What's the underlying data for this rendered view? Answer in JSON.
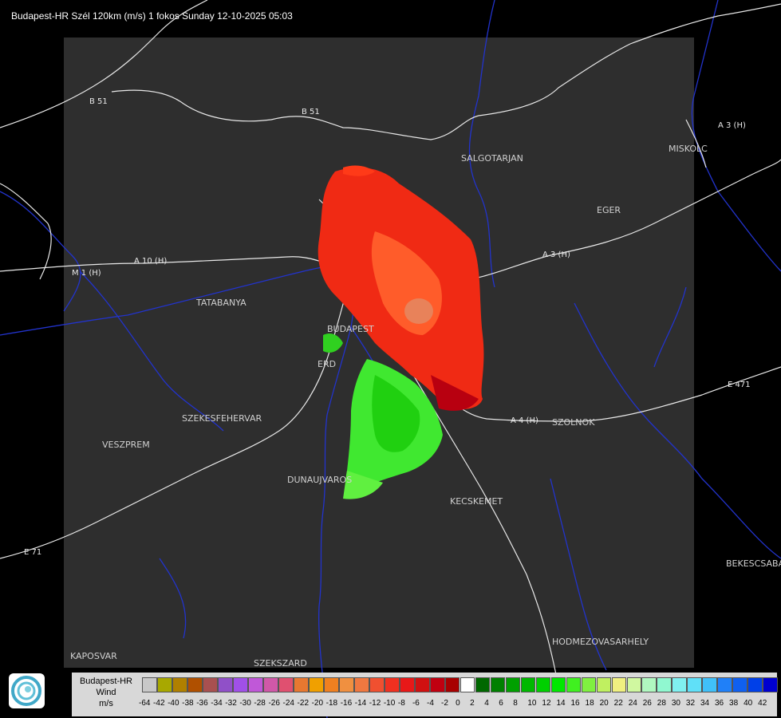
{
  "header": {
    "title": "Budapest-HR Szél 120km (m/s) 1 fokos Sunday 12-10-2025 05:03"
  },
  "cities": [
    {
      "name": "SALGOTARJAN"
    },
    {
      "name": "EGER"
    },
    {
      "name": "MISKOLC"
    },
    {
      "name": "TATABANYA"
    },
    {
      "name": "BUDAPEST"
    },
    {
      "name": "ERD"
    },
    {
      "name": "SZEKESFEHERVAR"
    },
    {
      "name": "VESZPREM"
    },
    {
      "name": "DUNAUJVAROS"
    },
    {
      "name": "KECSKEMET"
    },
    {
      "name": "SZOLNOK"
    },
    {
      "name": "BEKESCSABA"
    },
    {
      "name": "HODMEZOVASARHELY"
    },
    {
      "name": "KAPOSVAR"
    },
    {
      "name": "SZEKSZARD"
    }
  ],
  "roads": [
    "B 51",
    "B 51",
    "A 3 (H)",
    "A 3 (H)",
    "A 4 (H)",
    "E 71",
    "E 471",
    "M 1 (H)",
    "A 10 (H)"
  ],
  "legend": {
    "line1": "Budapest-HR",
    "line2": "Wind",
    "line3": "m/s",
    "colors": [
      "#c8c8c8",
      "#a8a800",
      "#b08000",
      "#b05000",
      "#a85050",
      "#9050c8",
      "#a050e8",
      "#c058d8",
      "#d058a8",
      "#e05070",
      "#e87830",
      "#f0a000",
      "#f08020",
      "#f09040",
      "#f07840",
      "#f05030",
      "#f03020",
      "#e81818",
      "#d01010",
      "#c00010",
      "#a80000",
      "#ffffff",
      "#006800",
      "#008000",
      "#00a000",
      "#00b800",
      "#00d000",
      "#00e800",
      "#40f020",
      "#80f040",
      "#c0f060",
      "#f0f080",
      "#d0f8a0",
      "#b0f8c0",
      "#90f8d0",
      "#80f0f0",
      "#60e0f8",
      "#40c0f8",
      "#2080f8",
      "#1060f0",
      "#0040e8",
      "#0000d0"
    ],
    "ticks": [
      "-64",
      "-42",
      "-40",
      "-38",
      "-36",
      "-34",
      "-32",
      "-30",
      "-28",
      "-26",
      "-24",
      "-22",
      "-20",
      "-18",
      "-16",
      "-14",
      "-12",
      "-10",
      "-8",
      "-6",
      "-4",
      "-2",
      "0",
      "2",
      "4",
      "6",
      "8",
      "10",
      "12",
      "14",
      "16",
      "18",
      "20",
      "22",
      "24",
      "26",
      "28",
      "30",
      "32",
      "34",
      "36",
      "38",
      "40",
      "42"
    ]
  }
}
